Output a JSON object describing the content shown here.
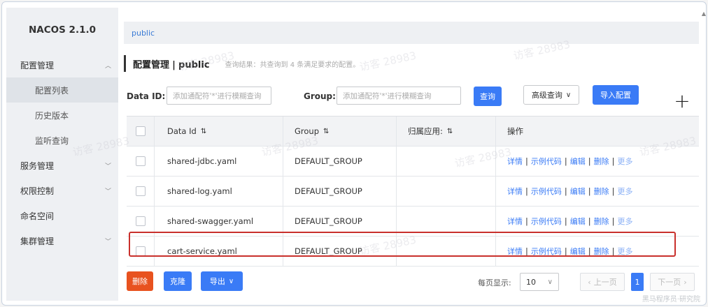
{
  "app": {
    "brand": "NACOS 2.1.0"
  },
  "sidebar": {
    "groups": [
      {
        "label": "配置管理",
        "expanded": true,
        "items": [
          {
            "label": "配置列表",
            "active": true
          },
          {
            "label": "历史版本",
            "active": false
          },
          {
            "label": "监听查询",
            "active": false
          }
        ]
      },
      {
        "label": "服务管理"
      },
      {
        "label": "权限控制"
      },
      {
        "label": "命名空间"
      },
      {
        "label": "集群管理"
      }
    ]
  },
  "namespace": {
    "current": "public"
  },
  "header": {
    "title_prefix": "配置管理",
    "separator": "|",
    "title_ns": "public",
    "result_text": "查询结果：共查询到 4 条满足要求的配置。"
  },
  "search": {
    "dataid_label": "Data ID:",
    "dataid_placeholder": "添加通配符'*'进行模糊查询",
    "group_label": "Group:",
    "group_placeholder": "添加通配符'*'进行模糊查询",
    "query_button": "查询",
    "advanced_button": "高级查询",
    "import_button": "导入配置",
    "add_icon": "plus-icon"
  },
  "table": {
    "headers": {
      "data_id": "Data Id",
      "group": "Group",
      "app": "归属应用:",
      "ops": "操作"
    },
    "ops": {
      "detail": "详情",
      "sample": "示例代码",
      "edit": "编辑",
      "delete": "删除",
      "more": "更多",
      "sep": "|"
    },
    "rows": [
      {
        "data_id": "shared-jdbc.yaml",
        "group": "DEFAULT_GROUP",
        "app": ""
      },
      {
        "data_id": "shared-log.yaml",
        "group": "DEFAULT_GROUP",
        "app": ""
      },
      {
        "data_id": "shared-swagger.yaml",
        "group": "DEFAULT_GROUP",
        "app": ""
      },
      {
        "data_id": "cart-service.yaml",
        "group": "DEFAULT_GROUP",
        "app": "",
        "highlighted": true
      }
    ]
  },
  "footer": {
    "delete_button": "删除",
    "clone_button": "克隆",
    "export_button": "导出",
    "per_page_label": "每页显示:",
    "per_page_value": "10",
    "prev_button": "上一页",
    "current_page": "1",
    "next_button": "下一页"
  },
  "colors": {
    "primary": "#3a7bf6",
    "danger": "#e8521f",
    "highlight_border": "#c9302c"
  },
  "watermark": {
    "text": "访客 28983",
    "corner_text": "黑马程序员·研究院"
  }
}
